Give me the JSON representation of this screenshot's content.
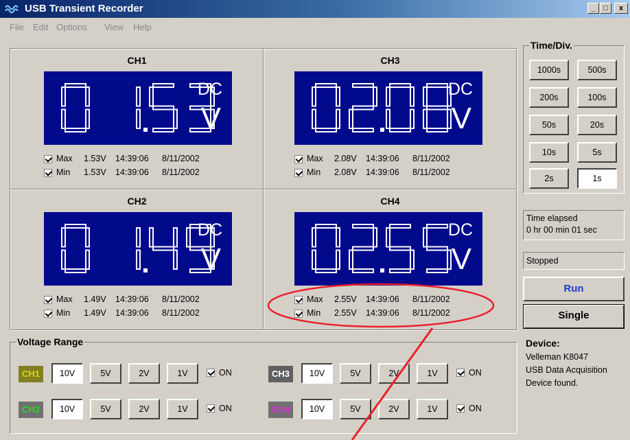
{
  "window": {
    "title": "USB Transient Recorder",
    "btn_min": "_",
    "btn_max": "□",
    "btn_close": "x"
  },
  "menu": [
    "File",
    "Edit",
    "Options",
    "View",
    "Help"
  ],
  "channels": {
    "ch1": {
      "label": "CH1",
      "digits": "0  1.53",
      "coupling": "DC",
      "unit": "V",
      "max": {
        "label": "Max",
        "value": "1.53V",
        "time": "14:39:06",
        "date": "8/11/2002"
      },
      "min": {
        "label": "Min",
        "value": "1.53V",
        "time": "14:39:06",
        "date": "8/11/2002"
      }
    },
    "ch3": {
      "label": "CH3",
      "digits": "02.08",
      "coupling": "DC",
      "unit": "V",
      "max": {
        "label": "Max",
        "value": "2.08V",
        "time": "14:39:06",
        "date": "8/11/2002"
      },
      "min": {
        "label": "Min",
        "value": "2.08V",
        "time": "14:39:06",
        "date": "8/11/2002"
      }
    },
    "ch2": {
      "label": "CH2",
      "digits": "0  1.49",
      "coupling": "DC",
      "unit": "V",
      "max": {
        "label": "Max",
        "value": "1.49V",
        "time": "14:39:06",
        "date": "8/11/2002"
      },
      "min": {
        "label": "Min",
        "value": "1.49V",
        "time": "14:39:06",
        "date": "8/11/2002"
      }
    },
    "ch4": {
      "label": "CH4",
      "digits": "02.55",
      "coupling": "DC",
      "unit": "V",
      "max": {
        "label": "Max",
        "value": "2.55V",
        "time": "14:39:06",
        "date": "8/11/2002"
      },
      "min": {
        "label": "Min",
        "value": "2.55V",
        "time": "14:39:06",
        "date": "8/11/2002"
      }
    }
  },
  "timediv": {
    "title": "Time/Div.",
    "buttons": [
      "1000s",
      "500s",
      "200s",
      "100s",
      "50s",
      "20s",
      "10s",
      "5s",
      "2s",
      "1s"
    ],
    "selected": "1s"
  },
  "elapsed": {
    "line1": "Time elapsed",
    "line2": "0 hr  00 min  01 sec"
  },
  "status": "Stopped",
  "run_label": "Run",
  "single_label": "Single",
  "device": {
    "title": "Device:",
    "line1": "Velleman  K8047",
    "line2": "USB Data Acquisition",
    "line3": "Device found."
  },
  "vrange": {
    "title": "Voltage Range",
    "ranges": [
      "10V",
      "5V",
      "2V",
      "1V"
    ],
    "on_label": "ON",
    "ch1": {
      "tag": "CH1",
      "color": "#d8d800",
      "bg": "#808020"
    },
    "ch2": {
      "tag": "CH2",
      "color": "#22dd22",
      "bg": "#707070"
    },
    "ch3": {
      "tag": "CH3",
      "color": "#ffffff",
      "bg": "#606060"
    },
    "ch4": {
      "tag": "CH4",
      "color": "#ee22ee",
      "bg": "#707070"
    }
  },
  "colors": {
    "display_bg": "#020a8c",
    "annotation": "#e8202a",
    "run_text": "#1d3ad0"
  }
}
